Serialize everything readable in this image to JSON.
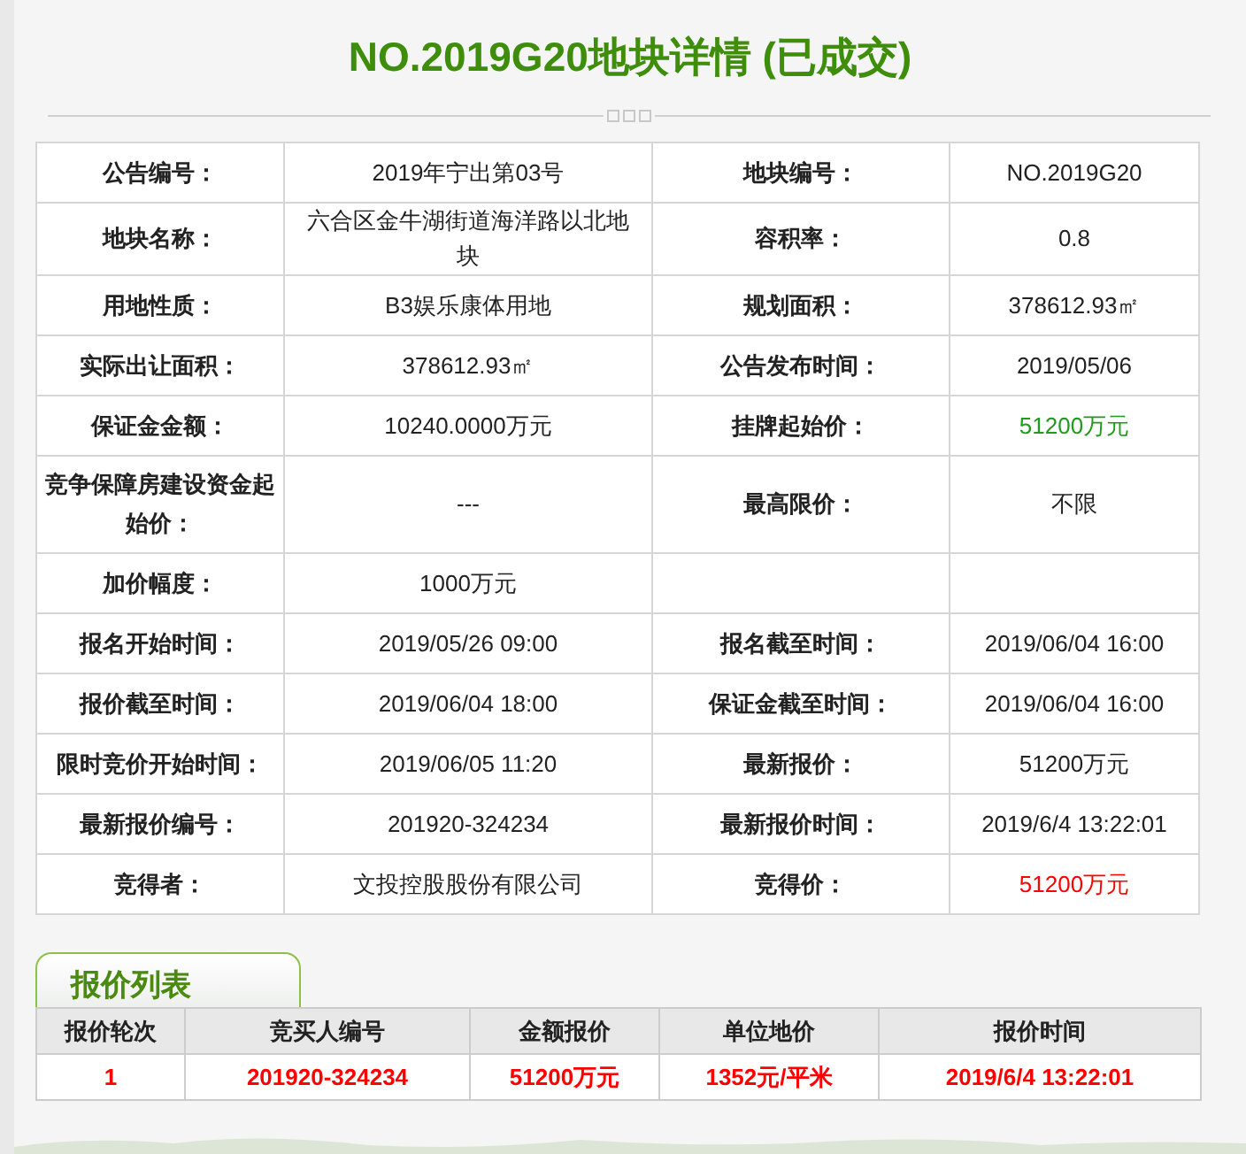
{
  "title": "NO.2019G20地块详情 (已成交)",
  "details": [
    {
      "cells": [
        {
          "label": "公告编号：",
          "value": "2019年宁出第03号"
        },
        {
          "label": "地块编号：",
          "value": "NO.2019G20"
        }
      ]
    },
    {
      "cells": [
        {
          "label": "地块名称：",
          "value": "六合区金牛湖街道海洋路以北地块"
        },
        {
          "label": "容积率：",
          "value": "0.8"
        }
      ]
    },
    {
      "cells": [
        {
          "label": "用地性质：",
          "value": "B3娱乐康体用地"
        },
        {
          "label": "规划面积：",
          "value": "378612.93㎡"
        }
      ]
    },
    {
      "cells": [
        {
          "label": "实际出让面积：",
          "value": "378612.93㎡"
        },
        {
          "label": "公告发布时间：",
          "value": "2019/05/06"
        }
      ]
    },
    {
      "cells": [
        {
          "label": "保证金金额：",
          "value": "10240.0000万元"
        },
        {
          "label": "挂牌起始价：",
          "value": "51200万元",
          "color": "#229a1d"
        }
      ]
    },
    {
      "cells": [
        {
          "label": "竞争保障房建设资金起始价：",
          "value": "---"
        },
        {
          "label": "最高限价：",
          "value": "不限"
        }
      ]
    },
    {
      "cells": [
        {
          "label": "加价幅度：",
          "value": "1000万元"
        }
      ]
    },
    {
      "cells": [
        {
          "label": "报名开始时间：",
          "value": "2019/05/26 09:00"
        },
        {
          "label": "报名截至时间：",
          "value": "2019/06/04 16:00"
        }
      ]
    },
    {
      "cells": [
        {
          "label": "报价截至时间：",
          "value": "2019/06/04 18:00"
        },
        {
          "label": "保证金截至时间：",
          "value": "2019/06/04 16:00"
        }
      ]
    },
    {
      "cells": [
        {
          "label": "限时竞价开始时间：",
          "value": "2019/06/05 11:20"
        },
        {
          "label": "最新报价：",
          "value": "51200万元"
        }
      ]
    },
    {
      "cells": [
        {
          "label": "最新报价编号：",
          "value": "201920-324234"
        },
        {
          "label": "最新报价时间：",
          "value": "2019/6/4 13:22:01"
        }
      ]
    },
    {
      "cells": [
        {
          "label": "竞得者：",
          "value": "文投控股股份有限公司"
        },
        {
          "label": "竞得价：",
          "value": "51200万元",
          "color": "#ff0000"
        }
      ]
    }
  ],
  "bids_tab": "报价列表",
  "bids": {
    "columns": [
      "报价轮次",
      "竞买人编号",
      "金额报价",
      "单位地价",
      "报价时间"
    ],
    "rows": [
      [
        "1",
        "201920-324234",
        "51200万元",
        "1352元/平米",
        "2019/6/4 13:22:01"
      ]
    ]
  }
}
